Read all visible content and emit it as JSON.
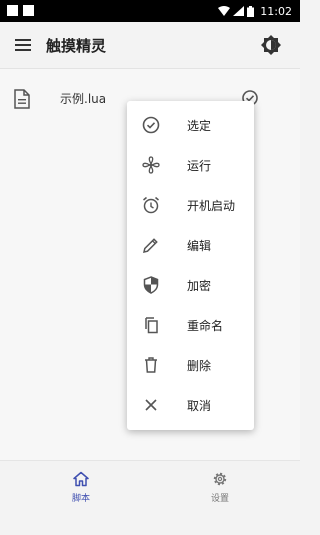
{
  "status_bar": {
    "time": "11:02"
  },
  "app_bar": {
    "title": "触摸精灵"
  },
  "file_list": {
    "items": [
      {
        "name": "示例.lua"
      }
    ]
  },
  "context_menu": {
    "items": [
      {
        "label": "选定",
        "icon": "check-circle-icon"
      },
      {
        "label": "运行",
        "icon": "fan-icon"
      },
      {
        "label": "开机启动",
        "icon": "alarm-clock-icon"
      },
      {
        "label": "编辑",
        "icon": "pencil-icon"
      },
      {
        "label": "加密",
        "icon": "shield-icon"
      },
      {
        "label": "重命名",
        "icon": "copy-icon"
      },
      {
        "label": "删除",
        "icon": "trash-icon"
      },
      {
        "label": "取消",
        "icon": "close-icon"
      }
    ]
  },
  "bottom_nav": {
    "items": [
      {
        "label": "脚本",
        "icon": "home-icon",
        "active": true
      },
      {
        "label": "设置",
        "icon": "gear-icon",
        "active": false
      }
    ]
  },
  "colors": {
    "accent": "#3f4fb0",
    "status_bar": "#000000",
    "icon_gray": "#555555"
  }
}
